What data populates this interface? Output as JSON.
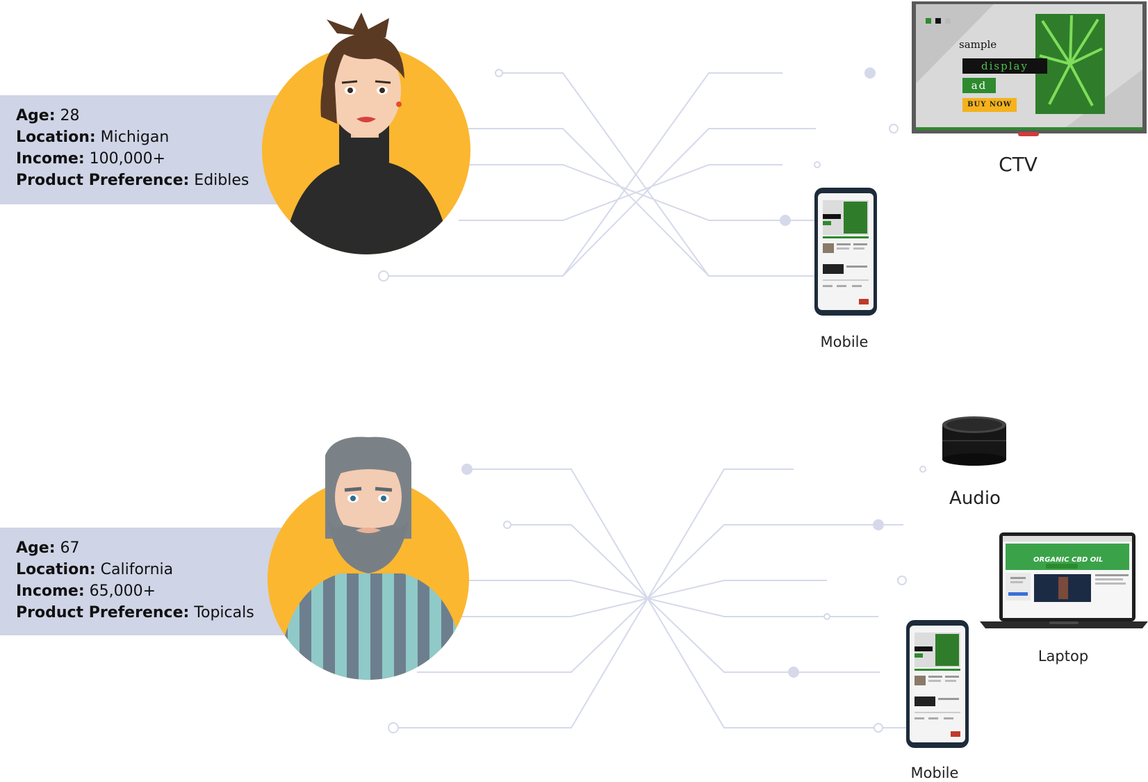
{
  "personas": [
    {
      "id": "woman",
      "fields": [
        {
          "label": "Age:",
          "value": "28"
        },
        {
          "label": "Location:",
          "value": "Michigan"
        },
        {
          "label": "Income:",
          "value": "100,000+"
        },
        {
          "label": "Product Preference:",
          "value": "Edibles"
        }
      ]
    },
    {
      "id": "man",
      "fields": [
        {
          "label": "Age:",
          "value": "67"
        },
        {
          "label": "Location:",
          "value": "California"
        },
        {
          "label": "Income:",
          "value": "65,000+"
        },
        {
          "label": "Product Preference:",
          "value": "Topicals"
        }
      ]
    }
  ],
  "devices": {
    "ctv": {
      "label": "CTV"
    },
    "mobile_top": {
      "label": "Mobile"
    },
    "audio": {
      "label": "Audio"
    },
    "laptop": {
      "label": "Laptop"
    },
    "mobile_bottom": {
      "label": "Mobile"
    }
  },
  "ctv_ad": {
    "line1": "sample",
    "line2": "display",
    "line3": "ad",
    "cta": "BUY NOW"
  },
  "laptop_ad": {
    "headline": "ORGANIC CBD OIL"
  },
  "colors": {
    "panel": "#cfd4e6",
    "avatar_circle": "#fbb730",
    "connector": "#d5d9ea",
    "ad_green": "#2e8a2e"
  }
}
